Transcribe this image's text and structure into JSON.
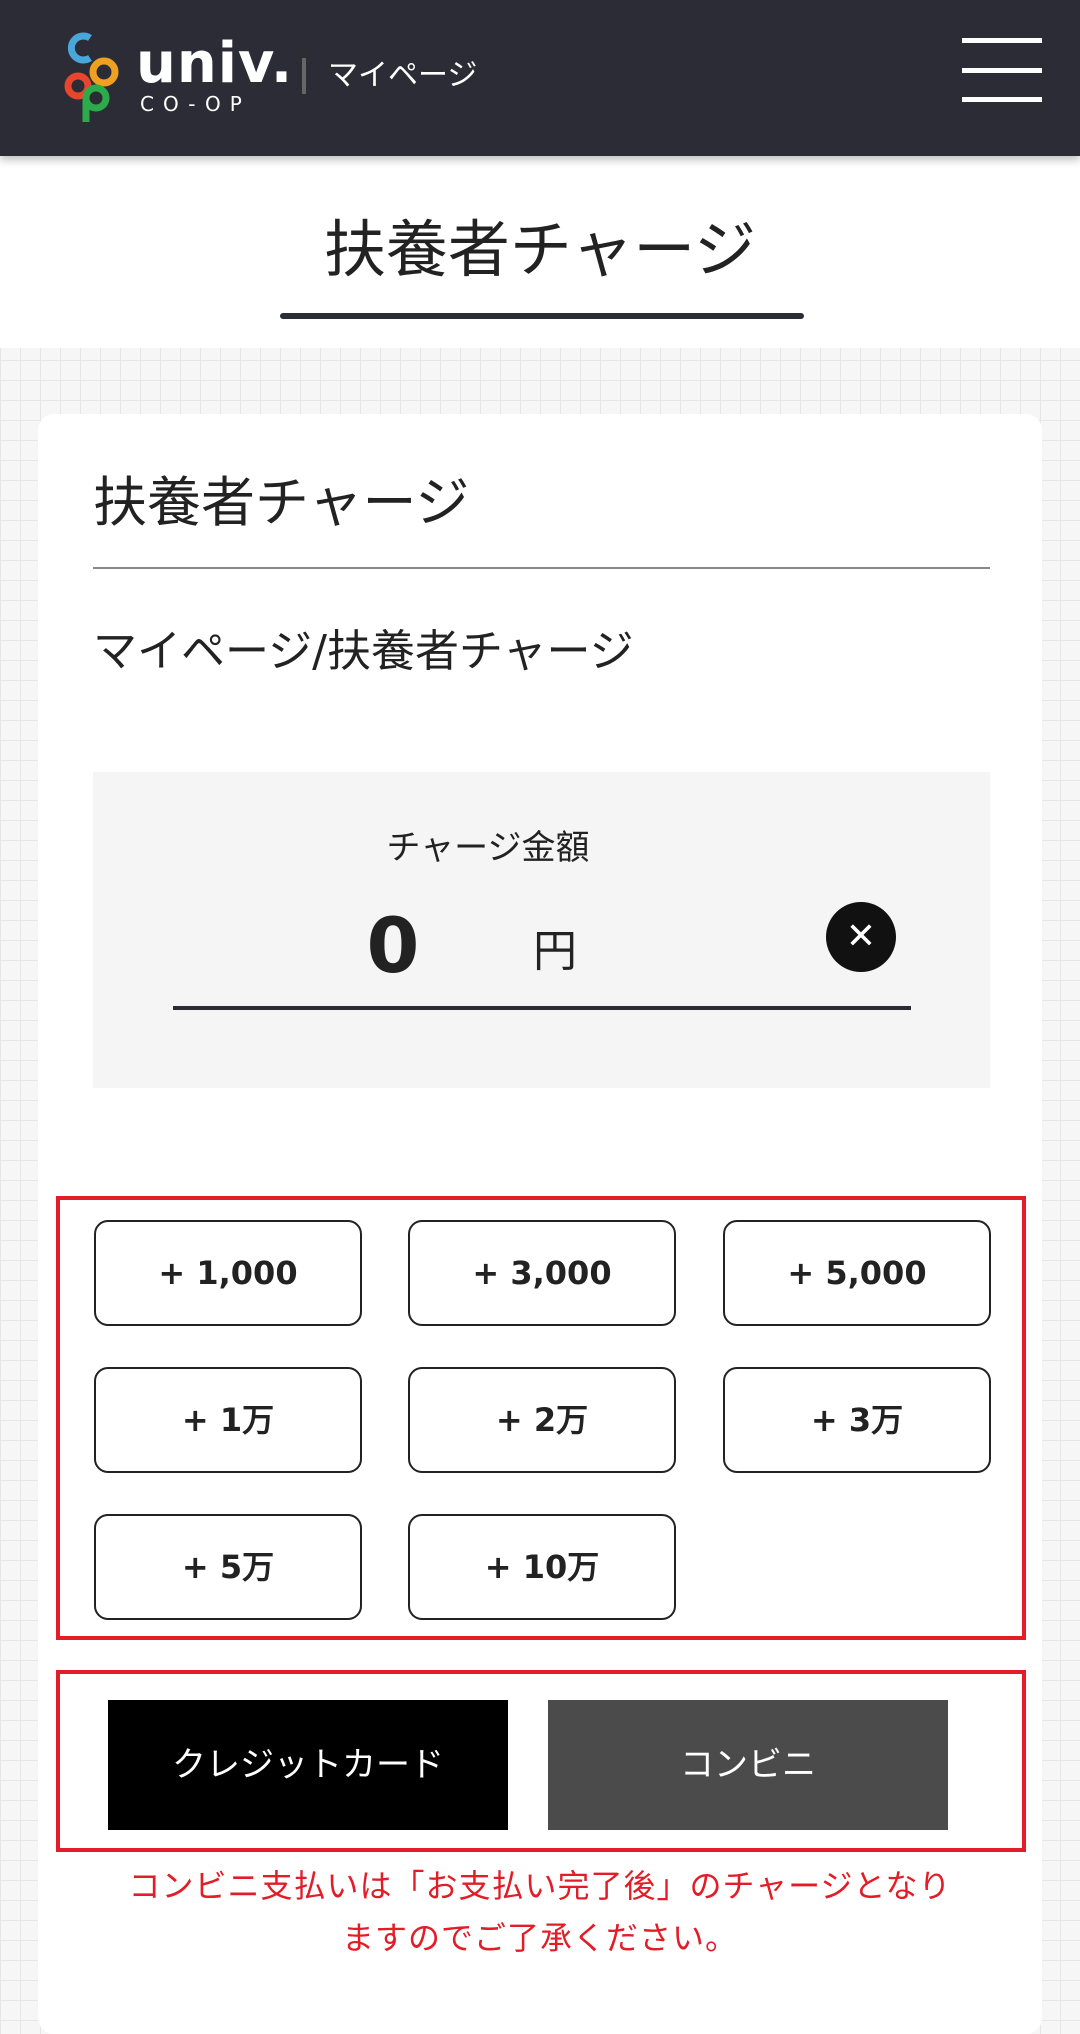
{
  "header": {
    "brand_name": "univ.",
    "brand_sub": "CO-OP",
    "title": "マイページ",
    "menu_icon": "hamburger-menu-icon"
  },
  "page": {
    "title": "扶養者チャージ"
  },
  "card": {
    "title": "扶養者チャージ",
    "breadcrumb": "マイページ/扶養者チャージ"
  },
  "charge": {
    "label": "チャージ金額",
    "value": "0",
    "unit": "円",
    "clear_icon": "close-icon",
    "clear_symbol": "✕"
  },
  "presets": [
    "+ 1,000",
    "+ 3,000",
    "+ 5,000",
    "+ 1万",
    "+ 2万",
    "+ 3万",
    "+ 5万",
    "+ 10万"
  ],
  "payment": {
    "credit": "クレジットカード",
    "convenience": "コンビニ"
  },
  "notice": {
    "line1": "コンビニ支払いは「お支払い完了後」のチャージとなり",
    "line2": "ますのでご了承ください。"
  },
  "colors": {
    "header_bg": "#2b2c36",
    "alert_red": "#e21d27",
    "credit_bg": "#000000",
    "convenience_bg": "#4b4b4b",
    "logo_blue": "#4aa6d9",
    "logo_orange": "#f0a020",
    "logo_red": "#e8452c",
    "logo_green": "#2daa4a"
  }
}
